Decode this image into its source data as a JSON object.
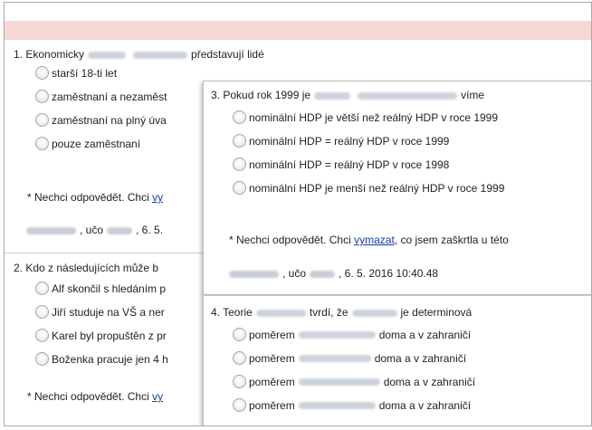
{
  "q1": {
    "title_prefix": "1. Ekonomicky",
    "title_suffix": "představují lidé",
    "options": [
      "starší 18-ti let",
      "zaměstnaní a nezaměst",
      "zaměstnaní na plný úva",
      "pouze zaměstnaní"
    ],
    "note_prefix": "* Nechci odpovědět. Chci",
    "note_link": "vy",
    "meta_prefix": ", učo",
    "meta_suffix": ", 6. 5."
  },
  "q2": {
    "title": "2. Kdo z následujících může b",
    "options": [
      "Alf skončil s hledáním p",
      "Jiří studuje na VŠ a ner",
      "Karel byl propuštěn z pr",
      "Boženka pracuje jen 4 h"
    ],
    "note_prefix": "* Nechci odpovědět. Chci",
    "note_link": "vy"
  },
  "q3": {
    "title_prefix": "3. Pokud rok 1999 je",
    "title_suffix": "víme",
    "options": [
      "nominální HDP je větší než reálný HDP v roce 1999",
      "nominální HDP = reálný HDP v roce 1999",
      "nominální HDP = reálný HDP v roce 1998",
      "nominální HDP je menší než reálný HDP v roce 1999"
    ],
    "note_prefix": "* Nechci odpovědět. Chci",
    "note_link": "vymazat",
    "note_suffix": ", co jsem zaškrtla u této",
    "meta_prefix": ", učo",
    "meta_suffix": ", 6. 5. 2016 10:40.48"
  },
  "q4": {
    "title_prefix": "4. Teorie",
    "title_mid": "tvrdí, že",
    "title_suffix": "je determinová",
    "option_prefix": "poměrem",
    "option_suffixes": [
      "doma a v zahraničí",
      "doma a v zahraničí",
      "doma a v zahraničí",
      "doma a v zahraničí"
    ]
  }
}
